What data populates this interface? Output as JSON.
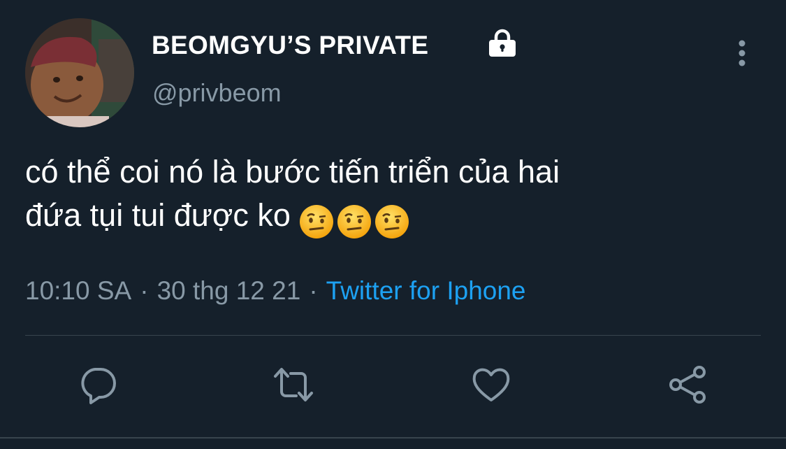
{
  "author": {
    "display_name": "BEOMGYU’S PRIVATE",
    "handle": "@privbeom",
    "protected": true
  },
  "tweet": {
    "line1": "có thể coi nó là bước tiến triển của hai",
    "line2": "đứa tụi tui được ko",
    "emojis": [
      "face-with-raised-eyebrow",
      "face-with-raised-eyebrow",
      "face-with-raised-eyebrow"
    ]
  },
  "meta": {
    "time": "10:10 SA",
    "date": "30 thg 12 21",
    "separator": "·",
    "source": "Twitter for Iphone"
  },
  "actions": [
    "reply",
    "retweet",
    "like",
    "share"
  ],
  "colors": {
    "background": "#15202b",
    "text": "#ffffff",
    "secondary": "#8899a6",
    "link": "#1da1f2",
    "divider": "#38444d"
  }
}
